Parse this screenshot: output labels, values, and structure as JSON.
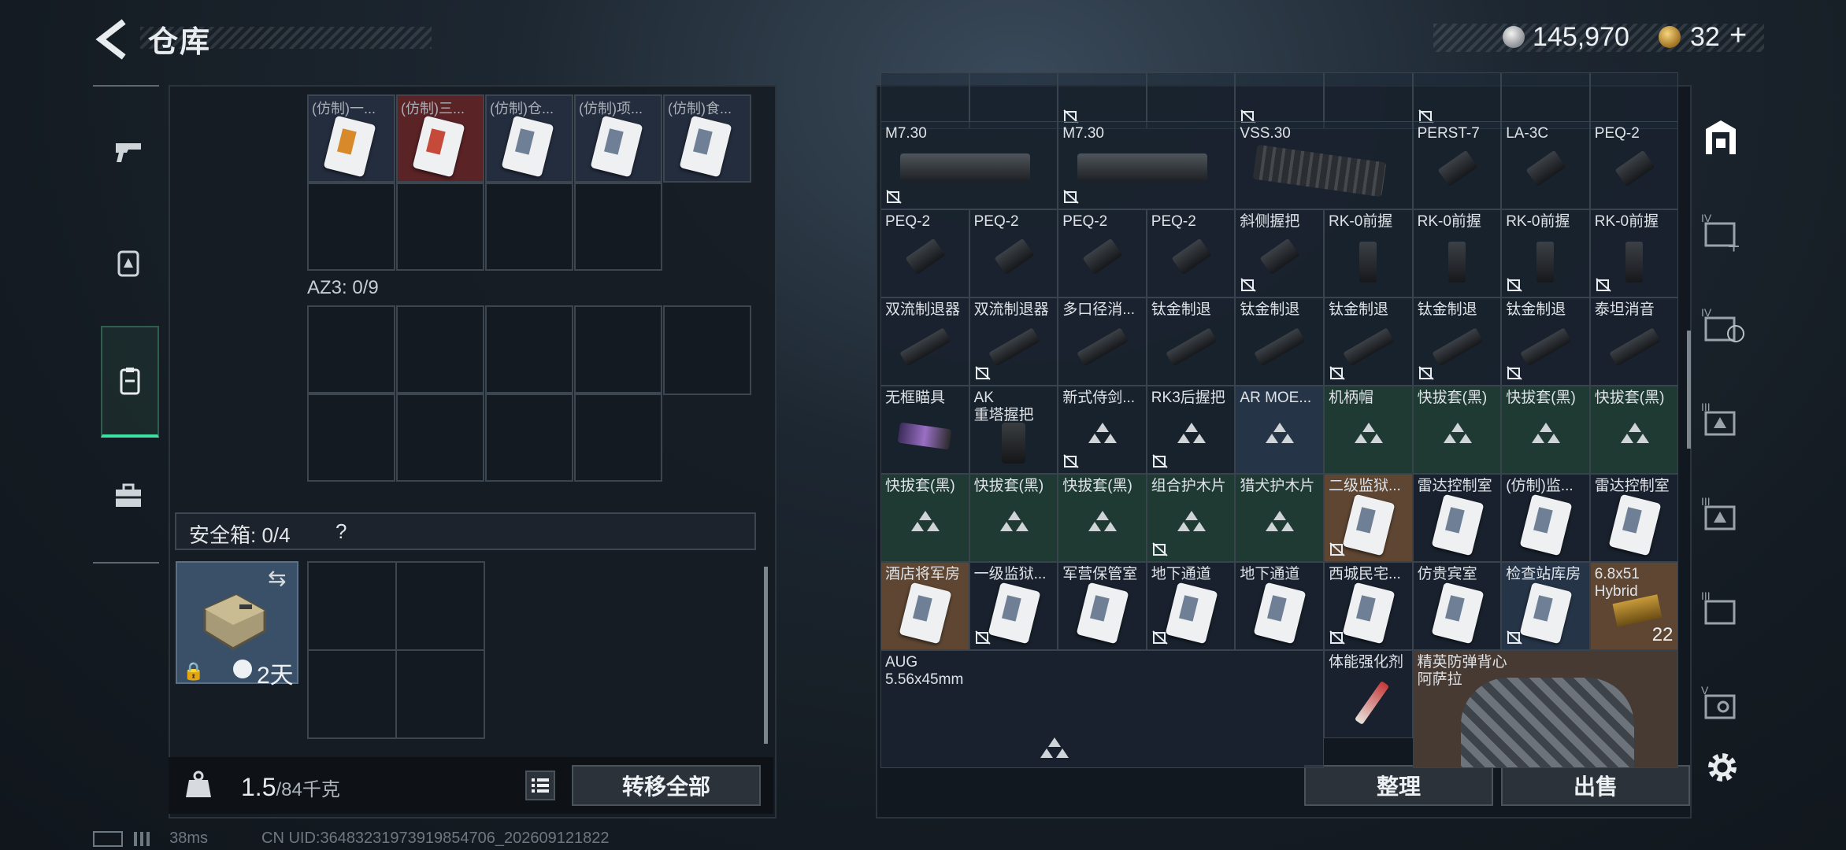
{
  "header": {
    "title": "仓库",
    "coin1": "145,970",
    "coin2": "32",
    "coin2_plus": "+"
  },
  "left": {
    "top_row_labels": [
      "(仿制)一...",
      "(仿制)三...",
      "(仿制)仓...",
      "(仿制)项...",
      "(仿制)食..."
    ],
    "az3_label": "AZ3: 0/9",
    "safe_label": "安全箱: 0/4",
    "safe_help": "?",
    "safe_timer": "2天",
    "weight_value": "1.5",
    "weight_cap": "/84千克",
    "transfer_label": "转移全部"
  },
  "grid": {
    "row0": [
      "",
      "",
      "",
      "",
      "",
      "",
      "",
      "",
      ""
    ],
    "row1": [
      "M7.30",
      "",
      "M7.30",
      "",
      "VSS.30",
      "",
      "PERST-7",
      "LA-3C",
      "PEQ-2"
    ],
    "row2": [
      "PEQ-2",
      "PEQ-2",
      "PEQ-2",
      "PEQ-2",
      "斜侧握把",
      "RK-0前握",
      "RK-0前握",
      "RK-0前握",
      "RK-0前握"
    ],
    "row3": [
      "双流制退器",
      "双流制退器",
      "多口径消...",
      "钛金制退",
      "钛金制退",
      "钛金制退",
      "钛金制退",
      "钛金制退",
      "泰坦消音"
    ],
    "row4": [
      "无框瞄具",
      "AK\n重塔握把",
      "新式侍剑...",
      "RK3后握把",
      "AR MOE...",
      "机柄帽",
      "快拔套(黑)",
      "快拔套(黑)",
      "快拔套(黑)"
    ],
    "row5": [
      "快拔套(黑)",
      "快拔套(黑)",
      "快拔套(黑)",
      "组合护木片",
      "猎犬护木片",
      "二级监狱...",
      "雷达控制室",
      "(仿制)监...",
      "雷达控制室"
    ],
    "row6": [
      "酒店将军房",
      "一级监狱...",
      "军营保管室",
      "地下通道",
      "地下通道",
      "西城民宅...",
      "仿贵宾室",
      "检查站库房",
      "6.8x51\nHybrid"
    ],
    "ammo_count": "22",
    "aug_label": "AUG\n5.56x45mm",
    "energy_label": "体能强化剂",
    "vest_label": "精英防弹背心\n阿萨拉"
  },
  "buttons": {
    "sort": "整理",
    "sell": "出售"
  },
  "footer": {
    "ping": "38ms",
    "uid": "CN UID:36483231973919854706_202609121822"
  },
  "colors": {
    "accent": "#3ee1a3",
    "gold_card_bg": "#5e4632",
    "green_cell_bg": "#1f3a33",
    "blue_cell_bg": "#253447"
  }
}
